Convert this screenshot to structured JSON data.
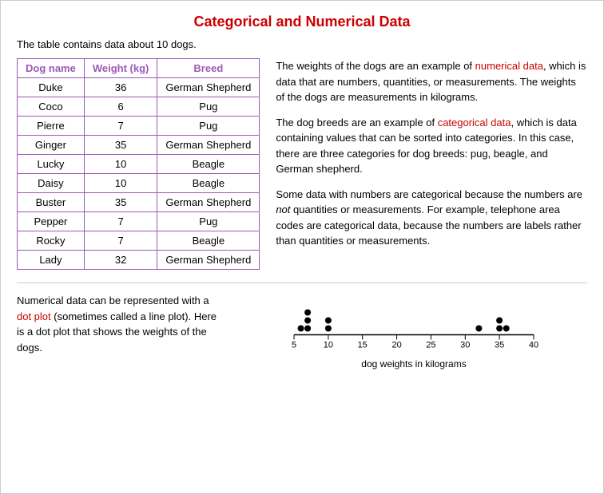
{
  "title": "Categorical and Numerical Data",
  "subtitle": "The table contains data about 10 dogs.",
  "table": {
    "headers": [
      "Dog name",
      "Weight (kg)",
      "Breed"
    ],
    "rows": [
      [
        "Duke",
        "36",
        "German Shepherd"
      ],
      [
        "Coco",
        "6",
        "Pug"
      ],
      [
        "Pierre",
        "7",
        "Pug"
      ],
      [
        "Ginger",
        "35",
        "German Shepherd"
      ],
      [
        "Lucky",
        "10",
        "Beagle"
      ],
      [
        "Daisy",
        "10",
        "Beagle"
      ],
      [
        "Buster",
        "35",
        "German Shepherd"
      ],
      [
        "Pepper",
        "7",
        "Pug"
      ],
      [
        "Rocky",
        "7",
        "Beagle"
      ],
      [
        "Lady",
        "32",
        "German Shepherd"
      ]
    ]
  },
  "text_paragraphs": {
    "p1_prefix": "The weights of the dogs are an example of ",
    "p1_highlight": "numerical data",
    "p1_suffix": ", which is data that are numbers, quantities, or measurements. The weights of the dogs are measurements in kilograms.",
    "p2_prefix": "The dog breeds are an example of ",
    "p2_highlight": "categorical data",
    "p2_suffix": ", which is data containing values that can be sorted into categories. In this case, there are three categories for dog breeds: pug, beagle, and German shepherd.",
    "p3": "Some data with numbers are categorical because the numbers are not quantities or measurements. For example, telephone area codes are categorical data, because the numbers are labels rather than quantities or measurements."
  },
  "bottom": {
    "text_prefix": "Numerical data can be represented with a ",
    "link_text": "dot plot",
    "text_suffix": " (sometimes called a line plot). Here is a dot plot that shows the weights of the dogs.",
    "dot_plot_label": "dog weights in kilograms",
    "axis_values": [
      "5",
      "10",
      "15",
      "20",
      "25",
      "30",
      "35",
      "40"
    ],
    "data_points": [
      6,
      7,
      7,
      7,
      10,
      10,
      32,
      35,
      35,
      36
    ]
  }
}
